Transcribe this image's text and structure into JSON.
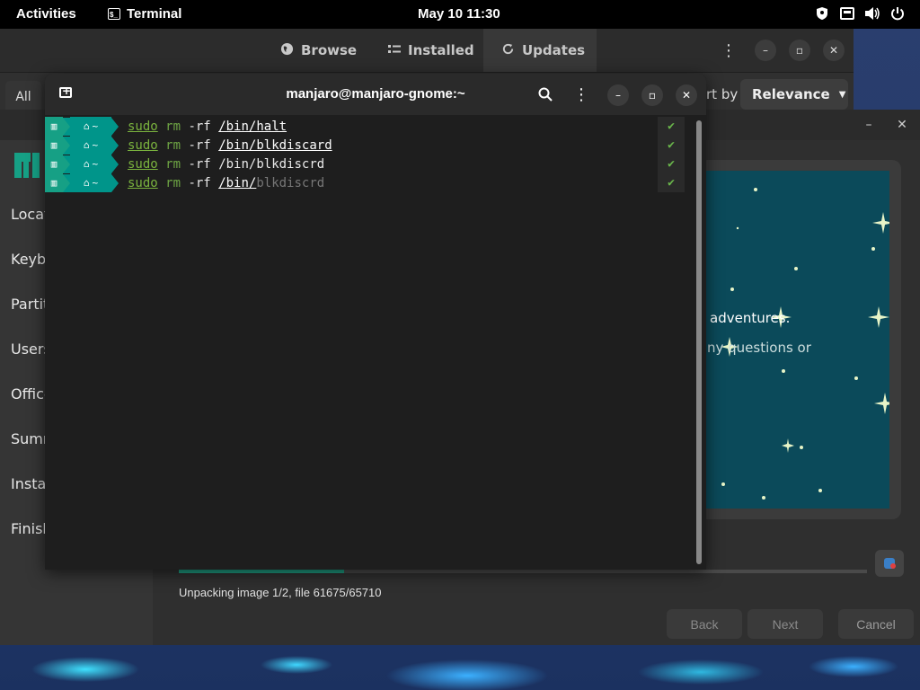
{
  "topbar": {
    "activities": "Activities",
    "app_name": "Terminal",
    "clock": "May 10  11:30",
    "tray_icons": [
      "shield-icon",
      "network-icon",
      "volume-icon",
      "power-icon"
    ]
  },
  "software_center": {
    "tabs": [
      {
        "label": "Browse",
        "icon": "globe-icon"
      },
      {
        "label": "Installed",
        "icon": "list-icon"
      },
      {
        "label": "Updates",
        "icon": "refresh-icon"
      }
    ],
    "all_label": "All",
    "sort_label": "rt by",
    "sort_value": "Relevance"
  },
  "installer": {
    "sidebar_items": [
      "Locat",
      "Keyb",
      "Partit",
      "Users",
      "Office",
      "Summ",
      "Insta",
      "Finish"
    ],
    "slide_text_1": "adventures.",
    "slide_text_2": "ny questions or",
    "progress_fraction": 0.24,
    "status": "Unpacking image 1/2, file 61675/65710",
    "buttons": {
      "back": "Back",
      "next": "Next",
      "cancel": "Cancel"
    }
  },
  "terminal": {
    "title": "manjaro@manjaro-gnome:~",
    "prompt_dir": "~",
    "lines": [
      {
        "sudo": "sudo",
        "rm": "rm",
        "flag": "-rf",
        "path": "/bin/halt",
        "rest": "",
        "path_underlined": true
      },
      {
        "sudo": "sudo",
        "rm": "rm",
        "flag": "-rf",
        "path": "/bin/blkdiscard",
        "rest": "",
        "path_underlined": true
      },
      {
        "sudo": "sudo",
        "rm": "rm",
        "flag": "-rf",
        "path": "/bin/blkdiscrd",
        "rest": "",
        "path_underlined": false
      },
      {
        "sudo": "sudo",
        "rm": "rm",
        "flag": "-rf",
        "path": "/bin/",
        "rest": "blkdiscrd",
        "path_underlined": true
      }
    ],
    "check_mark": "✔"
  },
  "colors": {
    "accent": "#16a085",
    "prompt_dark": "#00958a",
    "cmd_green": "#7ab33e",
    "slide_bg": "#0b4a5a"
  }
}
